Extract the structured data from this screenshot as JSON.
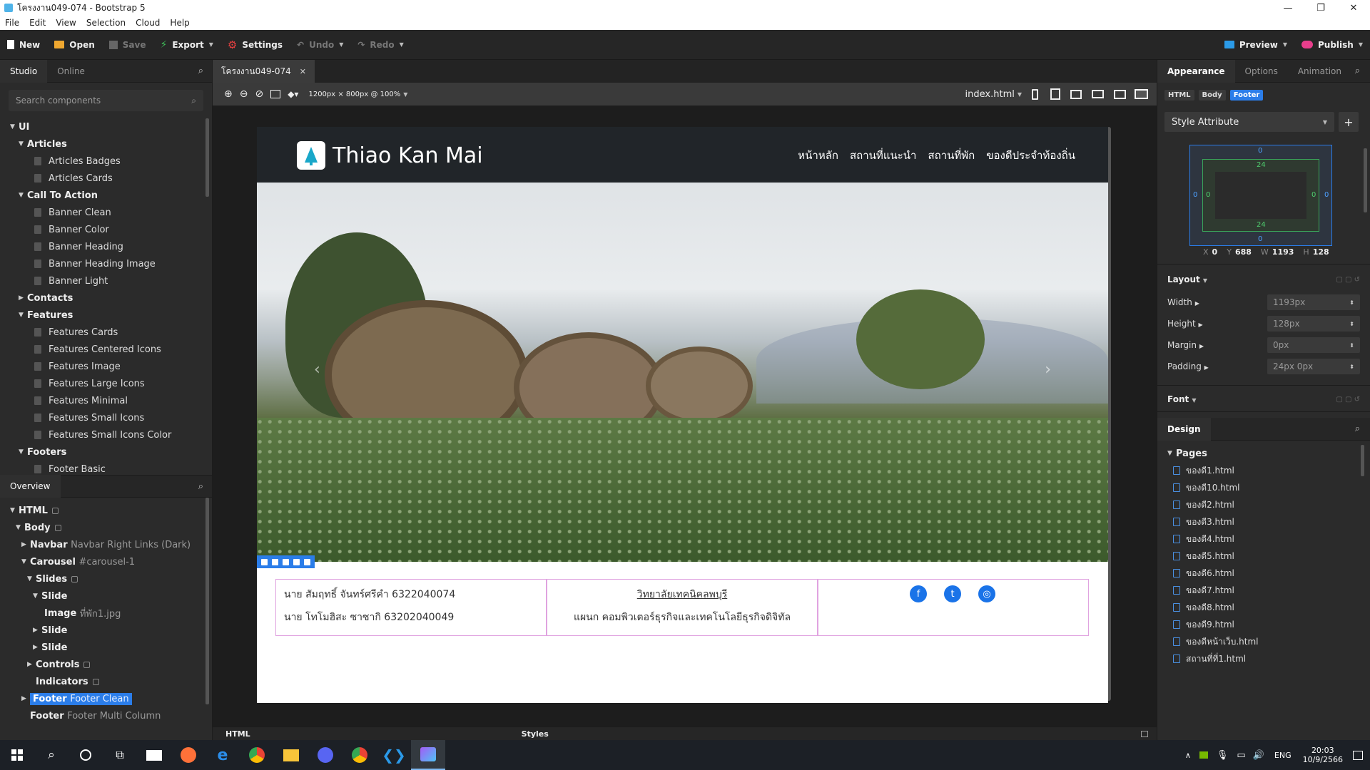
{
  "window": {
    "title": "โครงงาน049-074 - Bootstrap 5",
    "controls": [
      "—",
      "❐",
      "✕"
    ]
  },
  "menu": [
    "File",
    "Edit",
    "View",
    "Selection",
    "Cloud",
    "Help"
  ],
  "toolbar": {
    "new": "New",
    "open": "Open",
    "save": "Save",
    "export": "Export",
    "settings": "Settings",
    "undo": "Undo",
    "redo": "Redo",
    "preview": "Preview",
    "publish": "Publish"
  },
  "left": {
    "tabs": [
      "Studio",
      "Online"
    ],
    "search_placeholder": "Search components",
    "components": {
      "root": "UI",
      "articles": "Articles",
      "articles_items": [
        "Articles Badges",
        "Articles Cards"
      ],
      "cta": "Call To Action",
      "cta_items": [
        "Banner Clean",
        "Banner Color",
        "Banner Heading",
        "Banner Heading Image",
        "Banner Light"
      ],
      "contacts": "Contacts",
      "features": "Features",
      "features_items": [
        "Features Cards",
        "Features Centered Icons",
        "Features Image",
        "Features Large Icons",
        "Features Minimal",
        "Features Small Icons",
        "Features Small Icons Color"
      ],
      "footers": "Footers",
      "footers_items": [
        "Footer Basic"
      ]
    },
    "overview_title": "Overview",
    "overview": {
      "html": "HTML",
      "body": "Body",
      "navbar": "Navbar",
      "navbar_sub": "Navbar Right Links (Dark)",
      "carousel": "Carousel",
      "carousel_sub": "#carousel-1",
      "slides": "Slides",
      "slide": "Slide",
      "image": "Image",
      "image_sub": "ที่พัก1.jpg",
      "controls": "Controls",
      "indicators": "Indicators",
      "footer": "Footer",
      "footer_sub": "Footer Clean",
      "footer2_sub": "Footer Multi Column"
    }
  },
  "doc": {
    "tab": "โครงงาน049-074",
    "viewport": "1200px × 800px @ 100%",
    "file": "index.html"
  },
  "site": {
    "brand": "Thiao Kan Mai",
    "nav": [
      "หน้าหลัก",
      "สถานที่แนะนำ",
      "สถานที่พัก",
      "ของดีประจำท้องถิ่น"
    ],
    "footer": {
      "col1": [
        "นาย สัมฤทธิ์ จันทร์ศรีคำ 6322040074",
        "นาย โทโมฮิสะ ซาซากิ 63202040049"
      ],
      "col2_link": "วิทยาลัยเทคนิคลพบุรี",
      "col2_text": "แผนก คอมพิวเตอร์ธุรกิจและเทคโนโลยีธุรกิจดิจิทัล"
    }
  },
  "bottom": {
    "html": "HTML",
    "styles": "Styles"
  },
  "right": {
    "tabs": [
      "Appearance",
      "Options",
      "Animation"
    ],
    "crumbs": [
      "HTML",
      "Body",
      "Footer"
    ],
    "style_select": "Style Attribute",
    "box": {
      "margin_top": "0",
      "padding_top": "24",
      "padding_bottom": "24",
      "margin_bottom": "0",
      "left_margin": "0",
      "left_padding": "0",
      "right_padding": "0",
      "right_margin": "0"
    },
    "coords": {
      "x_label": "X",
      "x": "0",
      "y_label": "Y",
      "y": "688",
      "w_label": "W",
      "w": "1193",
      "h_label": "H",
      "h": "128"
    },
    "layout_title": "Layout",
    "props": [
      {
        "name": "Width",
        "value": "1193px"
      },
      {
        "name": "Height",
        "value": "128px"
      },
      {
        "name": "Margin",
        "value": "0px"
      },
      {
        "name": "Padding",
        "value": "24px 0px"
      }
    ],
    "font_title": "Font",
    "design_title": "Design",
    "pages_title": "Pages",
    "pages": [
      "ของดี1.html",
      "ของดี10.html",
      "ของดี2.html",
      "ของดี3.html",
      "ของดี4.html",
      "ของดี5.html",
      "ของดี6.html",
      "ของดี7.html",
      "ของดี8.html",
      "ของดี9.html",
      "ของดีหน้าเว็บ.html",
      "สถานที่ที่1.html"
    ]
  },
  "taskbar": {
    "lang": "ENG",
    "time": "20:03",
    "date": "10/9/2566"
  },
  "colors": {
    "accent": "#2b7de9",
    "canvas": "#1d1d1d",
    "navbar": "#212529"
  }
}
